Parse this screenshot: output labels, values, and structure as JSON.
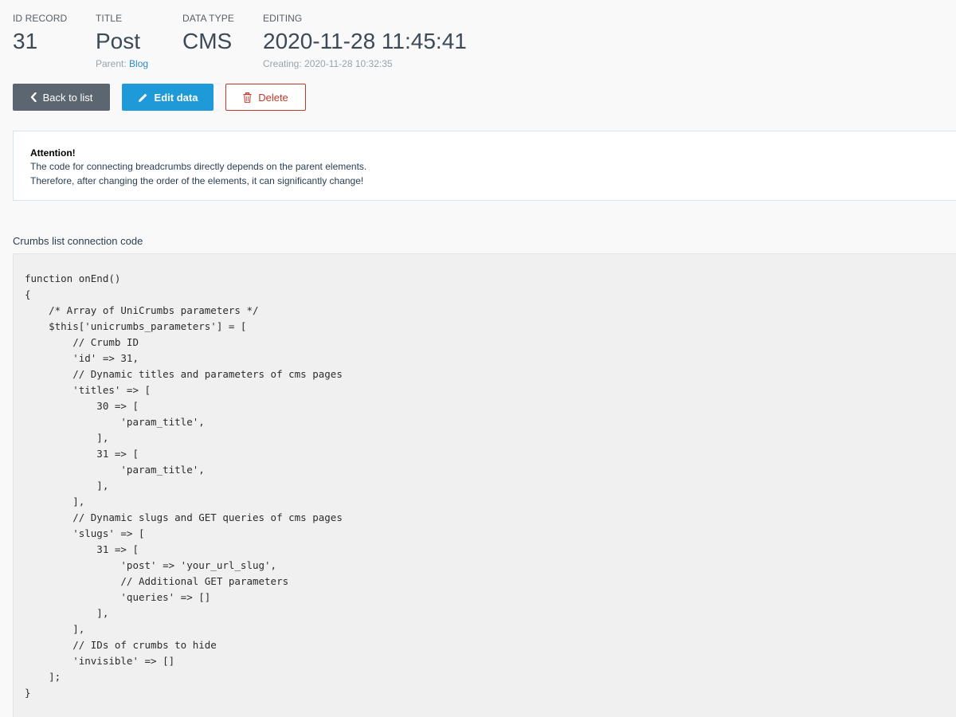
{
  "header": {
    "id_record": {
      "label": "ID RECORD",
      "value": "31"
    },
    "title": {
      "label": "TITLE",
      "value": "Post",
      "parent_prefix": "Parent:",
      "parent_link": "Blog"
    },
    "data_type": {
      "label": "DATA TYPE",
      "value": "CMS"
    },
    "editing": {
      "label": "EDITING",
      "value": "2020-11-28 11:45:41",
      "creating": "Creating: 2020-11-28 10:32:35"
    }
  },
  "toolbar": {
    "back_label": "Back to list",
    "edit_label": "Edit data",
    "delete_label": "Delete"
  },
  "callout": {
    "title": "Attention!",
    "line1": "The code for connecting breadcrumbs directly depends on the parent elements.",
    "line2": "Therefore, after changing the order of the elements, it can significantly change!"
  },
  "code_section": {
    "label": "Crumbs list connection code",
    "code": "function onEnd()\n{\n    /* Array of UniCrumbs parameters */\n    $this['unicrumbs_parameters'] = [\n        // Crumb ID\n        'id' => 31,\n        // Dynamic titles and parameters of cms pages\n        'titles' => [\n            30 => [\n                'param_title',\n            ],\n            31 => [\n                'param_title',\n            ],\n        ],\n        // Dynamic slugs and GET queries of cms pages\n        'slugs' => [\n            31 => [\n                'post' => 'your_url_slug',\n                // Additional GET parameters\n                'queries' => []\n            ],\n        ],\n        // IDs of crumbs to hide\n        'invisible' => []\n    ];\n}"
  },
  "icons": {
    "back": "chevron-left-icon",
    "edit": "pencil-icon",
    "delete": "trash-icon"
  },
  "colors": {
    "primary": "#1f9ad8",
    "secondary": "#5b6670",
    "danger": "#c0392b",
    "link": "#2a8bc6"
  }
}
